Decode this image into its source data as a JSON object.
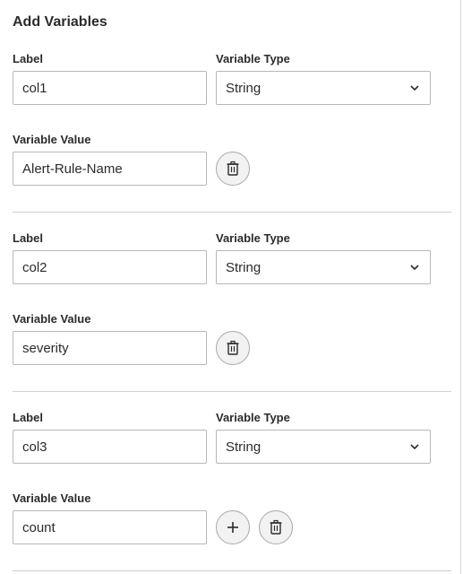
{
  "panel": {
    "title": "Add Variables"
  },
  "fields": {
    "label_label": "Label",
    "type_label": "Variable Type",
    "value_label": "Variable Value"
  },
  "variables": [
    {
      "label": "col1",
      "type": "String",
      "value": "Alert-Rule-Name"
    },
    {
      "label": "col2",
      "type": "String",
      "value": "severity"
    },
    {
      "label": "col3",
      "type": "String",
      "value": "count"
    }
  ],
  "icons": {
    "chevron": "chevron-down-icon",
    "delete": "trash-icon",
    "add": "plus-icon"
  }
}
